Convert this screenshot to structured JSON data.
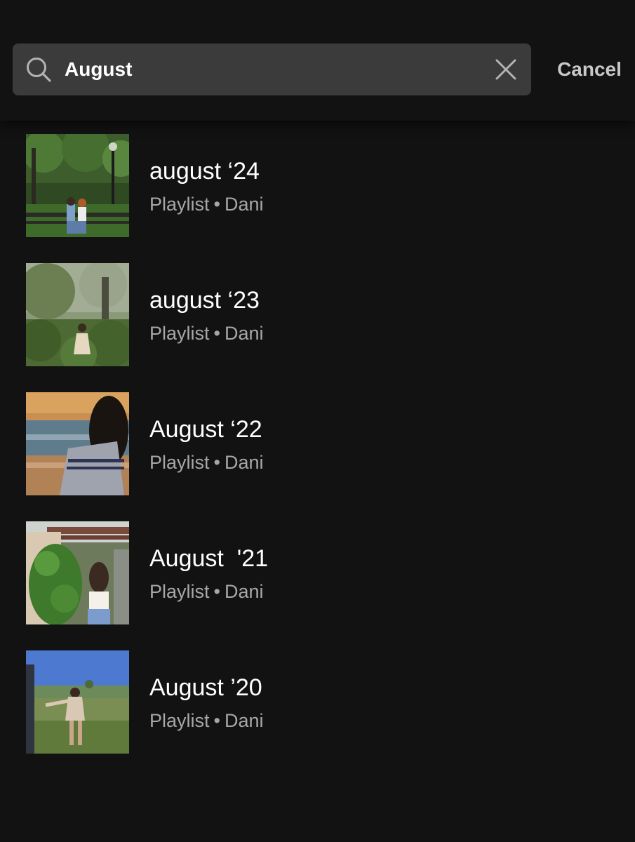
{
  "search": {
    "query": "August",
    "cancel_label": "Cancel",
    "search_icon": "search-icon",
    "clear_icon": "close-icon"
  },
  "results": [
    {
      "title": "august ‘24",
      "type": "Playlist",
      "separator": "•",
      "owner": "Dani",
      "cover": "park bench couple"
    },
    {
      "title": "august ‘23",
      "type": "Playlist",
      "separator": "•",
      "owner": "Dani",
      "cover": "foggy forest girl"
    },
    {
      "title": "August ‘22",
      "type": "Playlist",
      "separator": "•",
      "owner": "Dani",
      "cover": "beach sunset girl"
    },
    {
      "title": "August  '21",
      "type": "Playlist",
      "separator": "•",
      "owner": "Dani",
      "cover": "vine pergola girl"
    },
    {
      "title": "August ’20",
      "type": "Playlist",
      "separator": "•",
      "owner": "Dani",
      "cover": "meadow girl"
    }
  ],
  "colors": {
    "background": "#121212",
    "search_field": "#3b3b3b",
    "subtitle": "#a7a7a7",
    "cancel": "#c8c8c8"
  }
}
